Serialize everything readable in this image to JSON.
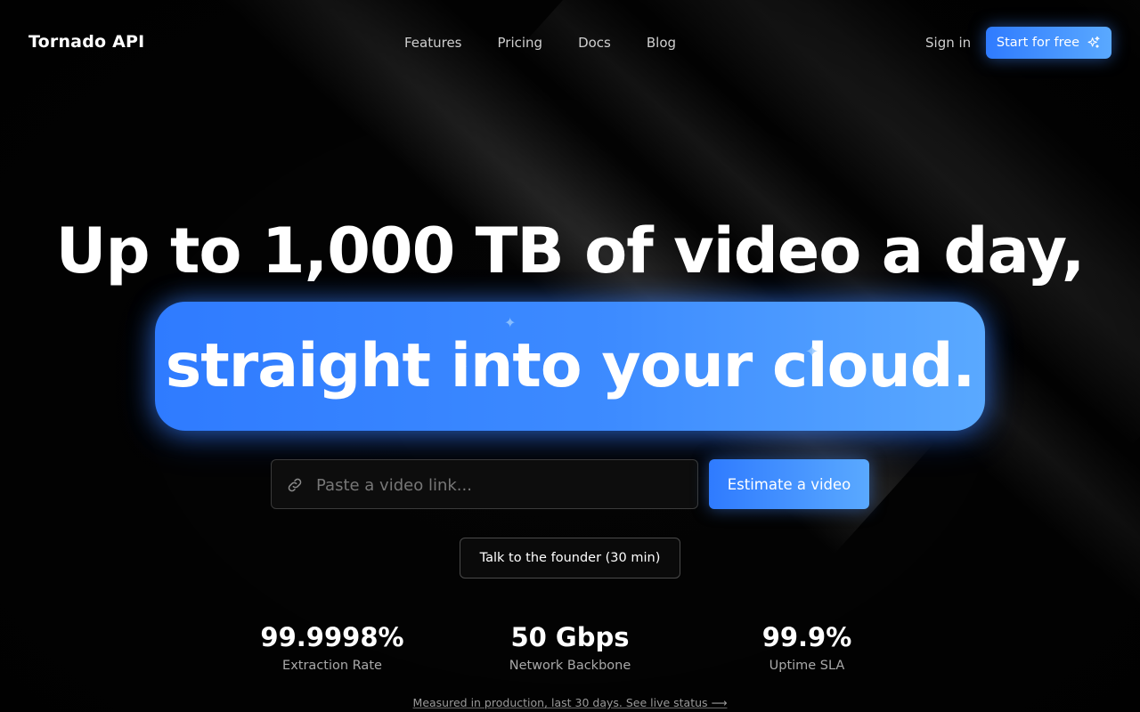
{
  "nav": {
    "logo": "Tornado API",
    "links": [
      "Features",
      "Pricing",
      "Docs",
      "Blog"
    ],
    "signin": "Sign in",
    "cta": "Start for free"
  },
  "hero": {
    "headline": "Up to 1,000 TB of video a day,",
    "highlight": "straight into your cloud."
  },
  "search": {
    "placeholder": "Paste a video link...",
    "value": "",
    "button": "Estimate a video"
  },
  "talk_button": "Talk to the founder (30 min)",
  "stats": [
    {
      "value": "99.9998%",
      "label": "Extraction Rate"
    },
    {
      "value": "50 Gbps",
      "label": "Network Backbone"
    },
    {
      "value": "99.9%",
      "label": "Uptime SLA"
    }
  ],
  "footnote": "Measured in production, last 30 days. See live status ⟶",
  "colors": {
    "accent": "#2f7bff",
    "accent_light": "#5aa9ff",
    "background": "#050505"
  },
  "icons": {
    "cta": "sparkles-icon",
    "search": "link-icon"
  }
}
